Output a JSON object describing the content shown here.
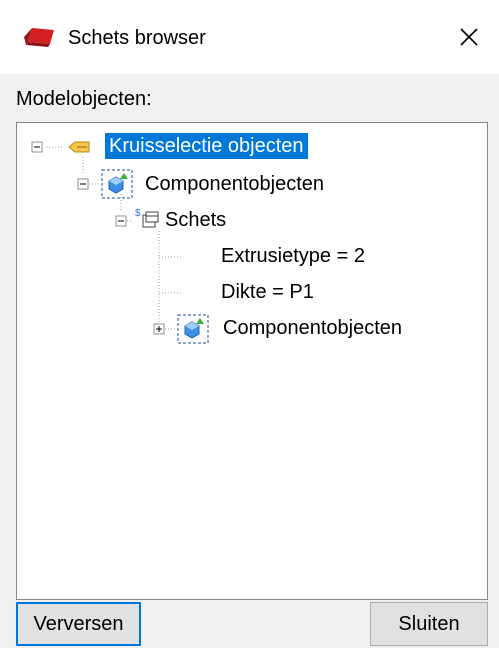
{
  "window": {
    "title": "Schets browser",
    "close_glyph": "✕",
    "app_icon": "red-book-icon"
  },
  "section_label": "Modelobjecten:",
  "tree": {
    "nodes": [
      {
        "label": "Kruisselectie objecten",
        "icon": "selection-icon",
        "expander": "collapse-minus",
        "selected": true
      },
      {
        "label": "Componentobjecten",
        "icon": "component-icon",
        "expander": "collapse-minus",
        "selected": false
      },
      {
        "label": "Schets",
        "icon": "sketch-icon",
        "expander": "collapse-minus",
        "selected": false
      },
      {
        "label": "Extrusietype = 2",
        "icon": "",
        "expander": "none",
        "selected": false
      },
      {
        "label": "Dikte = P1",
        "icon": "",
        "expander": "none",
        "selected": false
      },
      {
        "label": "Componentobjecten",
        "icon": "component-icon",
        "expander": "expand-plus",
        "selected": false
      }
    ],
    "selection_color": "#0078d7"
  },
  "buttons": {
    "refresh_label": "Verversen",
    "close_label": "Sluiten"
  }
}
